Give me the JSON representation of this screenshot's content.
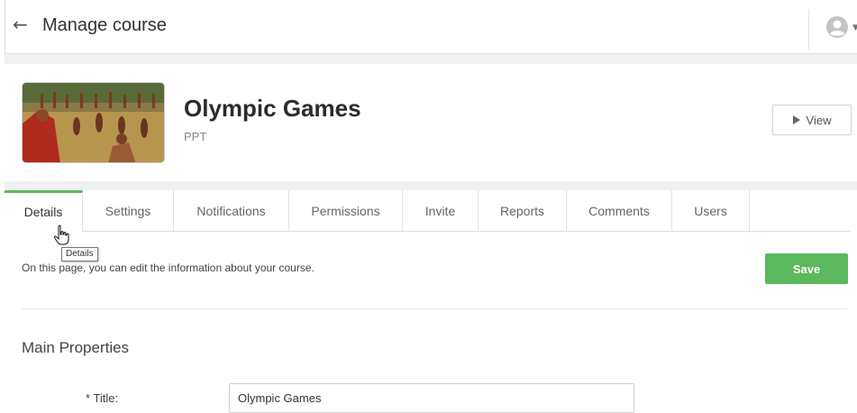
{
  "header": {
    "back_icon": "back-arrow-icon",
    "title": "Manage course",
    "avatar_icon": "user-avatar-icon"
  },
  "course": {
    "name": "Olympic Games",
    "type": "PPT",
    "view_label": "View"
  },
  "tabs": [
    {
      "label": "Details",
      "active": true
    },
    {
      "label": "Settings"
    },
    {
      "label": "Notifications"
    },
    {
      "label": "Permissions"
    },
    {
      "label": "Invite"
    },
    {
      "label": "Reports"
    },
    {
      "label": "Comments"
    },
    {
      "label": "Users"
    }
  ],
  "tooltip": "Details",
  "details": {
    "description": "On this page, you can edit the information about your course.",
    "save_label": "Save",
    "section_title": "Main Properties",
    "title_label": "* Title:",
    "title_value": "Olympic Games"
  },
  "colors": {
    "accent": "#5cb85c",
    "band": "#eff1f3"
  }
}
